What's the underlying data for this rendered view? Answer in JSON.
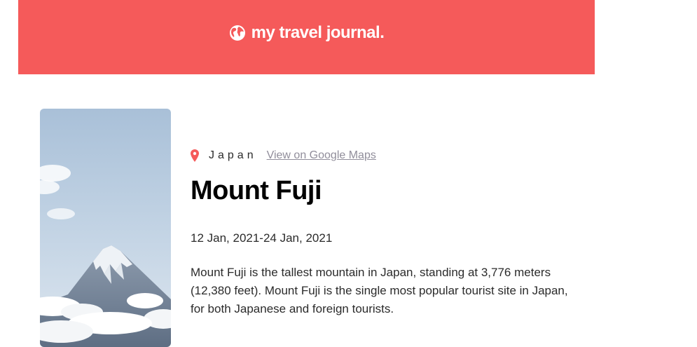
{
  "header": {
    "title": "my travel journal.",
    "icon": "globe-icon",
    "background": "#F55A5A"
  },
  "entry": {
    "location_icon": "map-pin-icon",
    "country": "Japan",
    "maps_link_label": "View on Google Maps",
    "title": "Mount Fuji",
    "dates": "12 Jan, 2021-24 Jan, 2021",
    "description": "Mount Fuji is the tallest mountain in Japan, standing at 3,776 meters (12,380 feet). Mount Fuji is the single most popular tourist site in Japan, for both Japanese and foreign tourists."
  },
  "colors": {
    "accent": "#F55A5A",
    "link": "#918E9B",
    "text": "#2B2B2B"
  }
}
